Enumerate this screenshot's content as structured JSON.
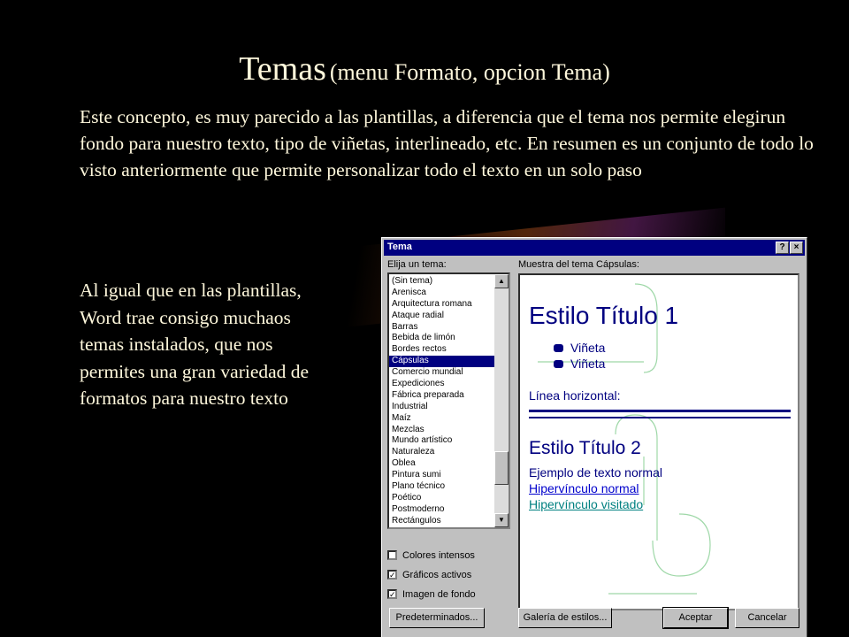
{
  "slide": {
    "title_main": "Temas",
    "title_sub": "(menu Formato, opcion Tema)",
    "intro": "Este concepto, es muy parecido a las plantillas, a diferencia que el tema nos permite elegirun fondo para nuestro texto, tipo de viñetas, interlineado, etc. En resumen es un conjunto de todo lo visto anteriormente que permite personalizar todo el texto en un solo paso",
    "side_text": "Al igual que en las plantillas, Word trae consigo muchaos temas instalados, que nos permites una gran variedad de formatos para nuestro texto"
  },
  "dialog": {
    "title": "Tema",
    "help_label": "?",
    "close_label": "×",
    "list_label": "Elija un tema:",
    "preview_label": "Muestra del tema Cápsulas:",
    "themes": [
      "(Sin tema)",
      "Arenisca",
      "Arquitectura romana",
      "Ataque radial",
      "Barras",
      "Bebida de limón",
      "Bordes rectos",
      "Cápsulas",
      "Comercio mundial",
      "Expediciones",
      "Fábrica preparada",
      "Industrial",
      "Maíz",
      "Mezclas",
      "Mundo artístico",
      "Naturaleza",
      "Oblea",
      "Pintura sumi",
      "Plano técnico",
      "Poético",
      "Postmoderno",
      "Rectángulos"
    ],
    "selected_index": 7,
    "preview": {
      "heading1": "Estilo Título 1",
      "bullets": [
        "Viñeta",
        "Viñeta"
      ],
      "hr_label": "Línea horizontal:",
      "heading2": "Estilo Título 2",
      "normal_text": "Ejemplo de texto normal",
      "link": "Hipervínculo normal",
      "visited_link": "Hipervínculo visitado"
    },
    "options": [
      {
        "label": "Colores intensos",
        "checked": false
      },
      {
        "label": "Gráficos activos",
        "checked": true
      },
      {
        "label": "Imagen de fondo",
        "checked": true
      }
    ],
    "buttons": {
      "defaults": "Predeterminados...",
      "gallery": "Galería de estilos...",
      "accept": "Aceptar",
      "cancel": "Cancelar"
    }
  }
}
